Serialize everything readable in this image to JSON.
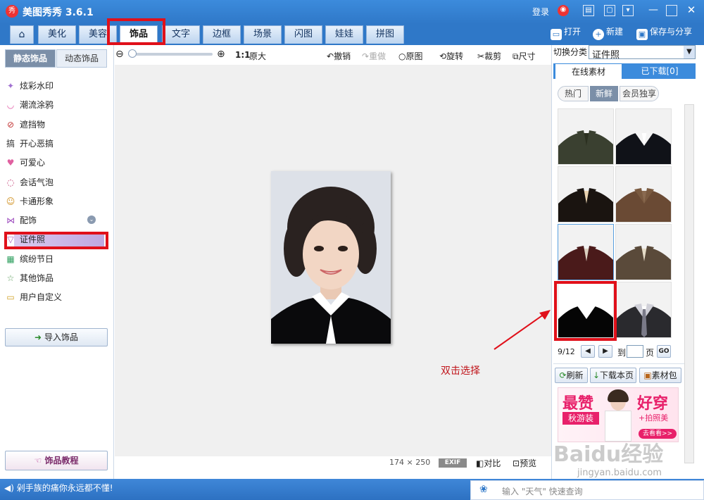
{
  "window": {
    "logo_text": "秀",
    "title": "美图秀秀 3.6.1",
    "login": "登录"
  },
  "nav": {
    "tabs": [
      "美化",
      "美容",
      "饰品",
      "文字",
      "边框",
      "场景",
      "闪图",
      "娃娃",
      "拼图"
    ],
    "active_tab": "饰品",
    "actions": {
      "open": "打开",
      "new": "新建",
      "save": "保存与分享"
    }
  },
  "left": {
    "tabs": [
      "静态饰品",
      "动态饰品"
    ],
    "items": [
      {
        "label": "炫彩水印",
        "icon": "sparkle-icon"
      },
      {
        "label": "潮流涂鸦",
        "icon": "lips-icon"
      },
      {
        "label": "遮挡物",
        "icon": "block-icon"
      },
      {
        "label": "开心恶搞",
        "icon": "prank-icon"
      },
      {
        "label": "可爱心",
        "icon": "heart-icon"
      },
      {
        "label": "会话气泡",
        "icon": "bubble-icon"
      },
      {
        "label": "卡通形象",
        "icon": "cartoon-icon"
      },
      {
        "label": "配饰",
        "icon": "bow-icon"
      },
      {
        "label": "证件照",
        "icon": "shirt-icon"
      },
      {
        "label": "缤纷节日",
        "icon": "gift-icon"
      },
      {
        "label": "其他饰品",
        "icon": "star-icon"
      },
      {
        "label": "用户自定义",
        "icon": "folder-icon"
      }
    ],
    "selected_item": "证件照",
    "import_button": "导入饰品",
    "tutorial_button": "饰品教程"
  },
  "toolbar": {
    "zoom_ratio": "1:1",
    "original_size": "原大",
    "undo": "撤销",
    "redo": "重做",
    "original": "原图",
    "rotate": "旋转",
    "crop": "裁剪",
    "resize": "尺寸"
  },
  "canvas": {
    "width": "174",
    "times": "×",
    "height": "250",
    "exif": "EXIF",
    "compare": "对比",
    "preview": "预览",
    "annotation": "双击选择"
  },
  "right": {
    "category_label": "切换分类",
    "category_value": "证件照",
    "tabs": [
      "在线素材",
      "已下载[0]"
    ],
    "filters": [
      "热门",
      "新鲜",
      "会员独享"
    ],
    "active_filter": "新鲜",
    "thumbnails": [
      {
        "name": "dark-green-blazer",
        "coat": "#3a4030",
        "inner": "#2b3020",
        "collar": "#3a4030"
      },
      {
        "name": "black-suit-white-collar",
        "coat": "#101218",
        "inner": "#ffffff",
        "collar": "#f4f4f4"
      },
      {
        "name": "black-jacket-beige-shirt",
        "coat": "#1a1410",
        "inner": "#e8d2b0",
        "collar": "#1a1410"
      },
      {
        "name": "brown-jacket-scarf",
        "coat": "#6a4a34",
        "inner": "#8a6a50",
        "collar": "#7a5a40"
      },
      {
        "name": "burgundy-blazer",
        "coat": "#4a1a1a",
        "inner": "#dcd0c0",
        "collar": "#4a1a1a"
      },
      {
        "name": "plaid-jacket",
        "coat": "#5a4a3a",
        "inner": "#e6dcc8",
        "collar": "#5a4a3a"
      },
      {
        "name": "black-top-white-collar",
        "coat": "#050505",
        "inner": "#ffffff",
        "collar": "#ffffff"
      },
      {
        "name": "grey-suit-tie",
        "coat": "#2a2a2e",
        "inner": "#ffffff",
        "collar": "#d0d0d8"
      }
    ],
    "selected_index": 4,
    "highlighted_index": 6,
    "page_current": "9/12",
    "goto_label": "到",
    "page_suffix": "页",
    "go_button": "GO",
    "refresh": "刷新",
    "download_page": "下载本页",
    "material_pack": "素材包",
    "ad": {
      "line1": "最赞",
      "line2": "秋游装",
      "line3": "好穿",
      "line4": "+拍照美",
      "line5": "去看看>>"
    }
  },
  "status": {
    "message": "剁手族的痛你永远都不懂!",
    "search_placeholder": "输入 \"天气\" 快速查询"
  },
  "watermark": {
    "line1": "Baidu经验",
    "line2": "jingyan.baidu.com"
  },
  "colors": {
    "accent": "#2f78c8",
    "highlight": "#e0101a"
  }
}
